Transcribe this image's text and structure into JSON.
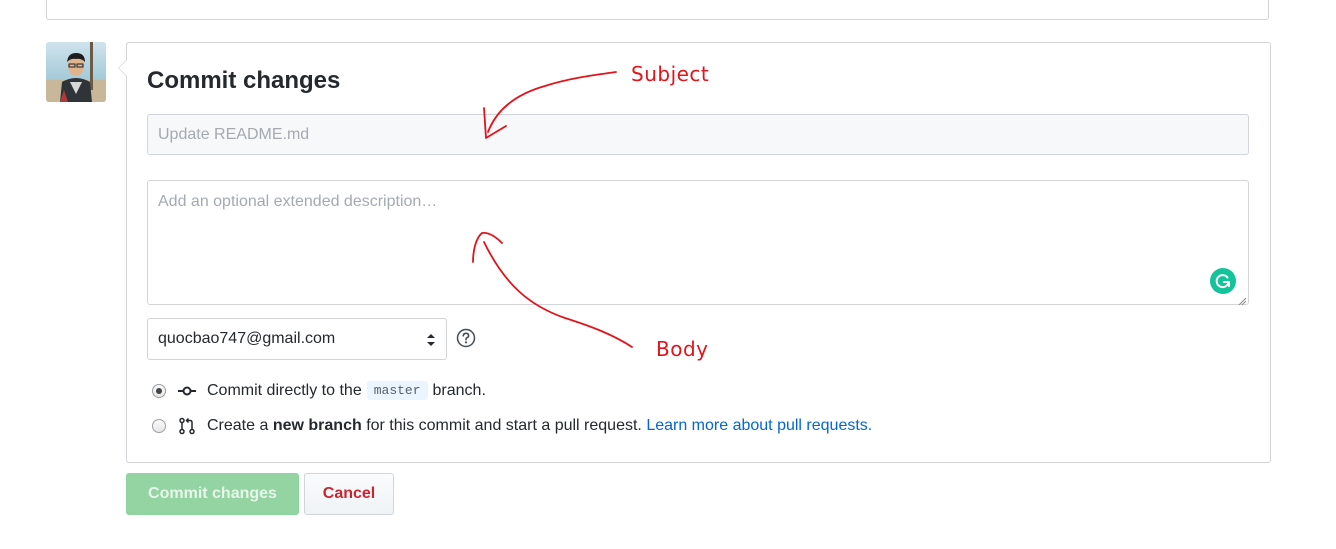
{
  "form": {
    "title": "Commit changes",
    "subject_placeholder": "Update README.md",
    "body_placeholder": "Add an optional extended description…",
    "email_selected": "quocbao747@gmail.com"
  },
  "options": {
    "direct": {
      "prefix": "Commit directly to the",
      "branch": "master",
      "suffix": "branch."
    },
    "new_branch": {
      "prefix": "Create a",
      "bold": "new branch",
      "suffix": "for this commit and start a pull request.",
      "link": "Learn more about pull requests."
    }
  },
  "buttons": {
    "commit": "Commit changes",
    "cancel": "Cancel"
  },
  "annotations": {
    "subject": "Subject",
    "body": "Body"
  },
  "colors": {
    "annotation": "#e2141b",
    "link": "#0366d6",
    "commit_button_disabled": "#94d3a2",
    "cancel_text": "#cb2431",
    "grammarly": "#15c39a"
  },
  "icons": {
    "commit_icon": "git-commit-icon",
    "branch_icon": "git-pull-request-icon",
    "help_icon": "question-circle-icon",
    "grammarly_icon": "grammarly-icon",
    "select_icon": "select-arrows-icon"
  }
}
